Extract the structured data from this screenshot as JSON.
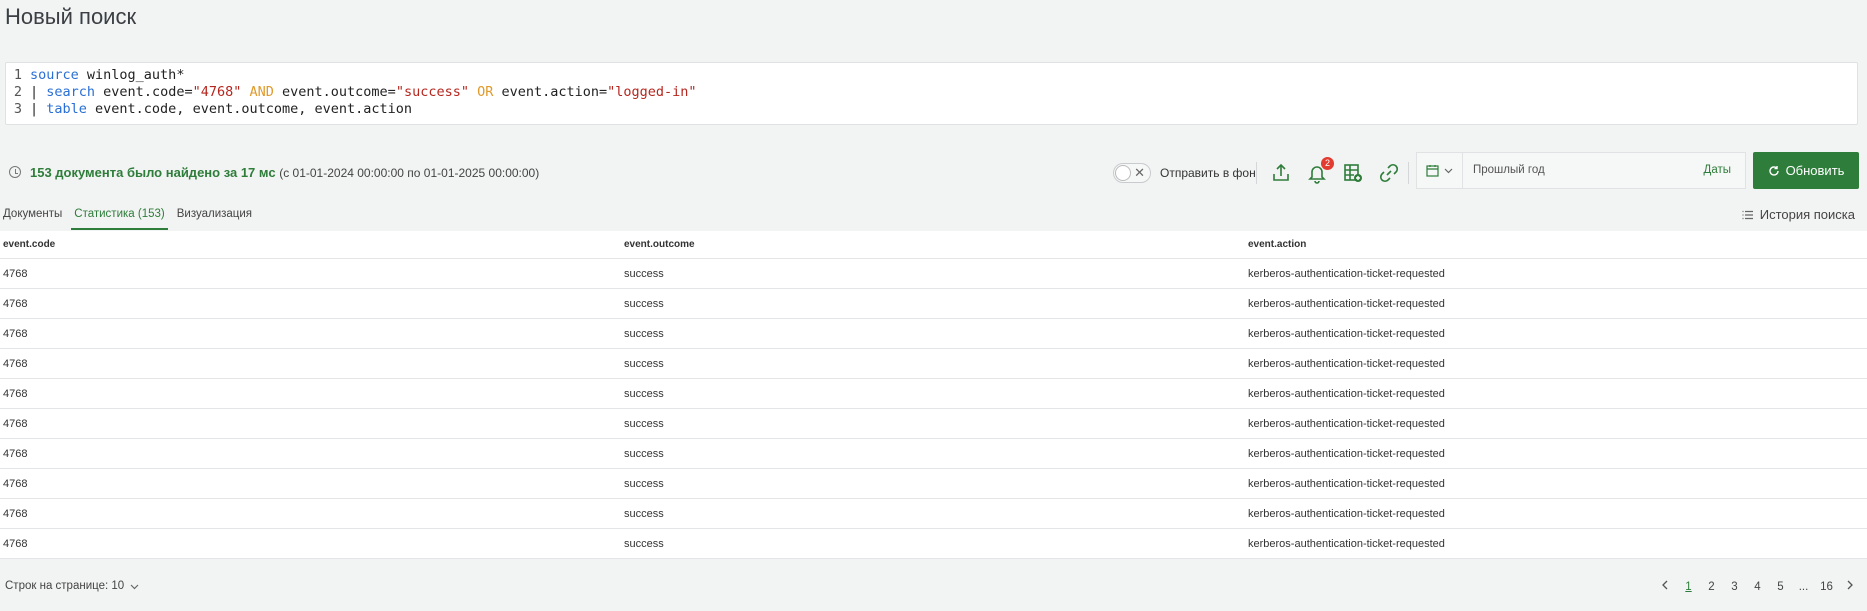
{
  "page": {
    "title": "Новый поиск"
  },
  "query": {
    "lines": [
      {
        "num": "1",
        "tokens": [
          {
            "t": "source",
            "c": "kw"
          },
          {
            "t": " winlog_auth*",
            "c": "pl"
          }
        ]
      },
      {
        "num": "2",
        "tokens": [
          {
            "t": "| ",
            "c": "pl"
          },
          {
            "t": "search",
            "c": "kw"
          },
          {
            "t": " event.code=",
            "c": "pl"
          },
          {
            "t": "\"4768\"",
            "c": "str"
          },
          {
            "t": " AND ",
            "c": "op"
          },
          {
            "t": "event.outcome=",
            "c": "pl"
          },
          {
            "t": "\"success\"",
            "c": "str"
          },
          {
            "t": " OR ",
            "c": "op"
          },
          {
            "t": "event.action=",
            "c": "pl"
          },
          {
            "t": "\"logged-in\"",
            "c": "str"
          }
        ]
      },
      {
        "num": "3",
        "tokens": [
          {
            "t": "| ",
            "c": "pl"
          },
          {
            "t": "table",
            "c": "kw"
          },
          {
            "t": " event.code, event.outcome, event.action",
            "c": "pl"
          }
        ]
      }
    ]
  },
  "status": {
    "found": "153 документа было найдено за 17 мс",
    "range": "(с 01-01-2024 00:00:00 по 01-01-2025 00:00:00)"
  },
  "toolbar": {
    "background_label": "Отправить в фон",
    "notifications_count": "2",
    "date_range": "Прошлый год",
    "dates_link": "Даты",
    "refresh_label": "Обновить"
  },
  "tabs": [
    {
      "label": "Документы",
      "active": false
    },
    {
      "label": "Статистика (153)",
      "active": true
    },
    {
      "label": "Визуализация",
      "active": false
    }
  ],
  "history_label": "История поиска",
  "table": {
    "columns": [
      "event.code",
      "event.outcome",
      "event.action"
    ],
    "rows": [
      [
        "4768",
        "success",
        "kerberos-authentication-ticket-requested"
      ],
      [
        "4768",
        "success",
        "kerberos-authentication-ticket-requested"
      ],
      [
        "4768",
        "success",
        "kerberos-authentication-ticket-requested"
      ],
      [
        "4768",
        "success",
        "kerberos-authentication-ticket-requested"
      ],
      [
        "4768",
        "success",
        "kerberos-authentication-ticket-requested"
      ],
      [
        "4768",
        "success",
        "kerberos-authentication-ticket-requested"
      ],
      [
        "4768",
        "success",
        "kerberos-authentication-ticket-requested"
      ],
      [
        "4768",
        "success",
        "kerberos-authentication-ticket-requested"
      ],
      [
        "4768",
        "success",
        "kerberos-authentication-ticket-requested"
      ],
      [
        "4768",
        "success",
        "kerberos-authentication-ticket-requested"
      ]
    ]
  },
  "footer": {
    "rows_per_page": "Строк на странице: 10",
    "pages": [
      "1",
      "2",
      "3",
      "4",
      "5",
      "...",
      "16"
    ],
    "current_page": "1"
  },
  "colors": {
    "accent": "#2e7d3a",
    "badge": "#e23b2f",
    "keyword": "#2a6fd6",
    "string": "#b5261e",
    "operator": "#e09a2b"
  }
}
